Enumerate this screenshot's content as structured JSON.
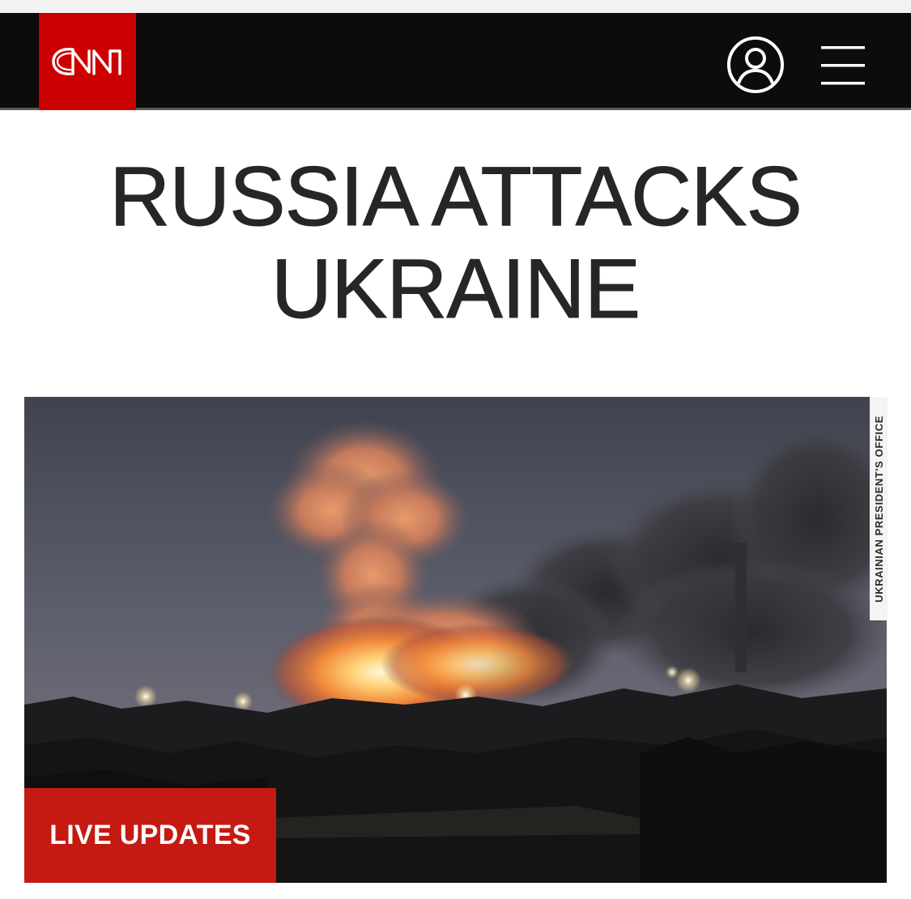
{
  "header": {
    "logo_text": "CNN",
    "account_icon": "user-circle-icon",
    "menu_icon": "hamburger-menu-icon",
    "colors": {
      "bar": "#0c0c0c",
      "logo_bg": "#cc0000"
    }
  },
  "headline": {
    "line1": "RUSSIA ATTACKS",
    "line2": "UKRAINE"
  },
  "photo": {
    "credit": "UKRAINIAN PRESIDENT'S OFFICE",
    "badge_label": "LIVE UPDATES",
    "badge_color": "#c41a12"
  }
}
